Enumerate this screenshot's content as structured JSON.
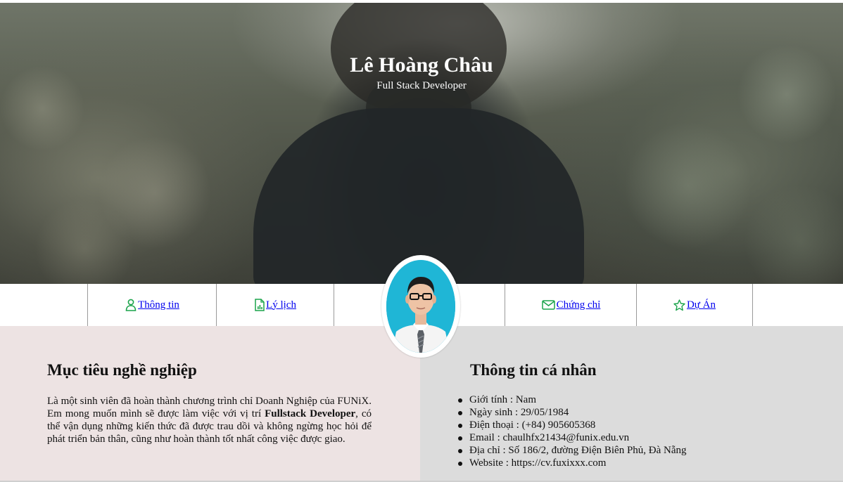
{
  "header": {
    "name": "Lê Hoàng Châu",
    "role": "Full Stack Developer"
  },
  "nav": {
    "items": [
      {
        "label": "Thông tin",
        "icon": "person-icon"
      },
      {
        "label": "Lý lịch",
        "icon": "document-icon"
      },
      {
        "label": "Chứng chỉ",
        "icon": "envelope-icon"
      },
      {
        "label": "Dự Án",
        "icon": "star-icon"
      }
    ]
  },
  "objective": {
    "title": "Mục tiêu nghề nghiệp",
    "text_part1": "Là một sinh viên đã hoàn thành chương trình chỉ Doanh Nghiệp của FUNiX. Em mong muốn mình sẽ được làm việc với vị trí ",
    "text_bold": "Fullstack Developer",
    "text_part2": ", có thể vận dụng những kiến thức đã được trau dồi và không ngừng học hỏi để phát triển bản thân, cũng như hoàn thành tốt nhất công việc được giao."
  },
  "personal_info": {
    "title": "Thông tin cá nhân",
    "items": [
      "Giới tính : Nam",
      "Ngày sinh : 29/05/1984",
      "Điện thoại : (+84) 905605368",
      "Email : chaulhfx21434@funix.edu.vn",
      "Địa chỉ : Số 186/2, đường Điện Biên Phủ, Đà Nẵng",
      "Website : https://cv.fuxixxx.com"
    ]
  },
  "colors": {
    "link": "#0000ee",
    "icon_green": "#1aa34a",
    "left_panel": "#ede3e3",
    "right_panel": "#dcdcdc",
    "avatar_bg": "#1fb6d6"
  }
}
